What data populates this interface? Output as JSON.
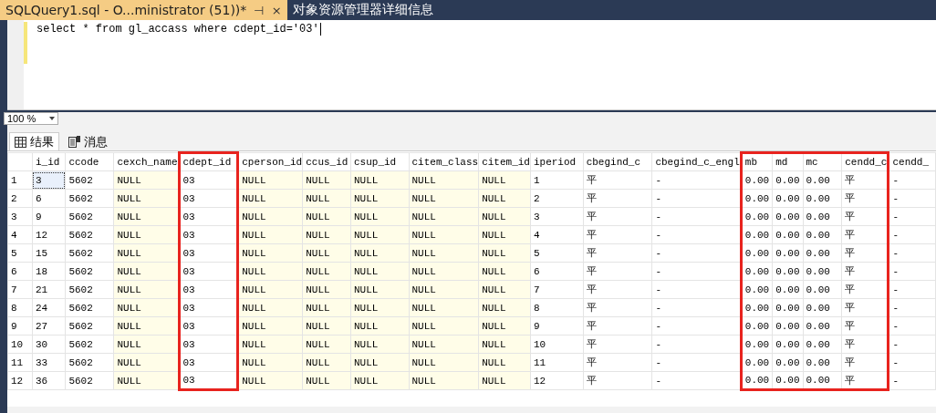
{
  "document_tabs": [
    {
      "label": "SQLQuery1.sql - O...ministrator (51))*",
      "selected": true,
      "pin": "⊣",
      "close": "×"
    },
    {
      "label": "对象资源管理器详细信息",
      "selected": false
    }
  ],
  "editor": {
    "line": "select * from gl_accass where cdept_id='03'"
  },
  "zoom": {
    "value": "100 %"
  },
  "result_tabs": [
    {
      "label": "结果",
      "kind": "grid",
      "selected": true
    },
    {
      "label": "消息",
      "kind": "messages",
      "selected": false
    }
  ],
  "grid": {
    "columns": [
      {
        "label": "i_id",
        "shaded": false,
        "highlighted": false
      },
      {
        "label": "ccode",
        "shaded": false,
        "highlighted": false
      },
      {
        "label": "cexch_name",
        "shaded": true,
        "highlighted": false
      },
      {
        "label": "cdept_id",
        "shaded": false,
        "highlighted": true
      },
      {
        "label": "cperson_id",
        "shaded": true,
        "highlighted": false
      },
      {
        "label": "ccus_id",
        "shaded": true,
        "highlighted": false
      },
      {
        "label": "csup_id",
        "shaded": true,
        "highlighted": false
      },
      {
        "label": "citem_class",
        "shaded": true,
        "highlighted": false
      },
      {
        "label": "citem_id",
        "shaded": true,
        "highlighted": false
      },
      {
        "label": "iperiod",
        "shaded": false,
        "highlighted": false
      },
      {
        "label": "cbegind_c",
        "shaded": false,
        "highlighted": false
      },
      {
        "label": "cbegind_c_engl",
        "shaded": false,
        "highlighted": false
      },
      {
        "label": "mb",
        "shaded": false,
        "highlighted": true
      },
      {
        "label": "md",
        "shaded": false,
        "highlighted": true
      },
      {
        "label": "mc",
        "shaded": false,
        "highlighted": true
      },
      {
        "label": "cendd_c",
        "shaded": false,
        "highlighted": true
      },
      {
        "label": "cendd_",
        "shaded": false,
        "highlighted": false
      }
    ],
    "rows": [
      {
        "number": "1",
        "focused": true,
        "cells": [
          "3",
          "5602",
          "NULL",
          "03",
          "NULL",
          "NULL",
          "NULL",
          "NULL",
          "NULL",
          "1",
          "平",
          "-",
          "0.00",
          "0.00",
          "0.00",
          "平",
          "-"
        ]
      },
      {
        "number": "2",
        "focused": false,
        "cells": [
          "6",
          "5602",
          "NULL",
          "03",
          "NULL",
          "NULL",
          "NULL",
          "NULL",
          "NULL",
          "2",
          "平",
          "-",
          "0.00",
          "0.00",
          "0.00",
          "平",
          "-"
        ]
      },
      {
        "number": "3",
        "focused": false,
        "cells": [
          "9",
          "5602",
          "NULL",
          "03",
          "NULL",
          "NULL",
          "NULL",
          "NULL",
          "NULL",
          "3",
          "平",
          "-",
          "0.00",
          "0.00",
          "0.00",
          "平",
          "-"
        ]
      },
      {
        "number": "4",
        "focused": false,
        "cells": [
          "12",
          "5602",
          "NULL",
          "03",
          "NULL",
          "NULL",
          "NULL",
          "NULL",
          "NULL",
          "4",
          "平",
          "-",
          "0.00",
          "0.00",
          "0.00",
          "平",
          "-"
        ]
      },
      {
        "number": "5",
        "focused": false,
        "cells": [
          "15",
          "5602",
          "NULL",
          "03",
          "NULL",
          "NULL",
          "NULL",
          "NULL",
          "NULL",
          "5",
          "平",
          "-",
          "0.00",
          "0.00",
          "0.00",
          "平",
          "-"
        ]
      },
      {
        "number": "6",
        "focused": false,
        "cells": [
          "18",
          "5602",
          "NULL",
          "03",
          "NULL",
          "NULL",
          "NULL",
          "NULL",
          "NULL",
          "6",
          "平",
          "-",
          "0.00",
          "0.00",
          "0.00",
          "平",
          "-"
        ]
      },
      {
        "number": "7",
        "focused": false,
        "cells": [
          "21",
          "5602",
          "NULL",
          "03",
          "NULL",
          "NULL",
          "NULL",
          "NULL",
          "NULL",
          "7",
          "平",
          "-",
          "0.00",
          "0.00",
          "0.00",
          "平",
          "-"
        ]
      },
      {
        "number": "8",
        "focused": false,
        "cells": [
          "24",
          "5602",
          "NULL",
          "03",
          "NULL",
          "NULL",
          "NULL",
          "NULL",
          "NULL",
          "8",
          "平",
          "-",
          "0.00",
          "0.00",
          "0.00",
          "平",
          "-"
        ]
      },
      {
        "number": "9",
        "focused": false,
        "cells": [
          "27",
          "5602",
          "NULL",
          "03",
          "NULL",
          "NULL",
          "NULL",
          "NULL",
          "NULL",
          "9",
          "平",
          "-",
          "0.00",
          "0.00",
          "0.00",
          "平",
          "-"
        ]
      },
      {
        "number": "10",
        "focused": false,
        "cells": [
          "30",
          "5602",
          "NULL",
          "03",
          "NULL",
          "NULL",
          "NULL",
          "NULL",
          "NULL",
          "10",
          "平",
          "-",
          "0.00",
          "0.00",
          "0.00",
          "平",
          "-"
        ]
      },
      {
        "number": "11",
        "focused": false,
        "cells": [
          "33",
          "5602",
          "NULL",
          "03",
          "NULL",
          "NULL",
          "NULL",
          "NULL",
          "NULL",
          "11",
          "平",
          "-",
          "0.00",
          "0.00",
          "0.00",
          "平",
          "-"
        ]
      },
      {
        "number": "12",
        "focused": false,
        "cells": [
          "36",
          "5602",
          "NULL",
          "03",
          "NULL",
          "NULL",
          "NULL",
          "NULL",
          "NULL",
          "12",
          "平",
          "-",
          "0.00",
          "0.00",
          "0.00",
          "平",
          "-"
        ]
      }
    ]
  }
}
